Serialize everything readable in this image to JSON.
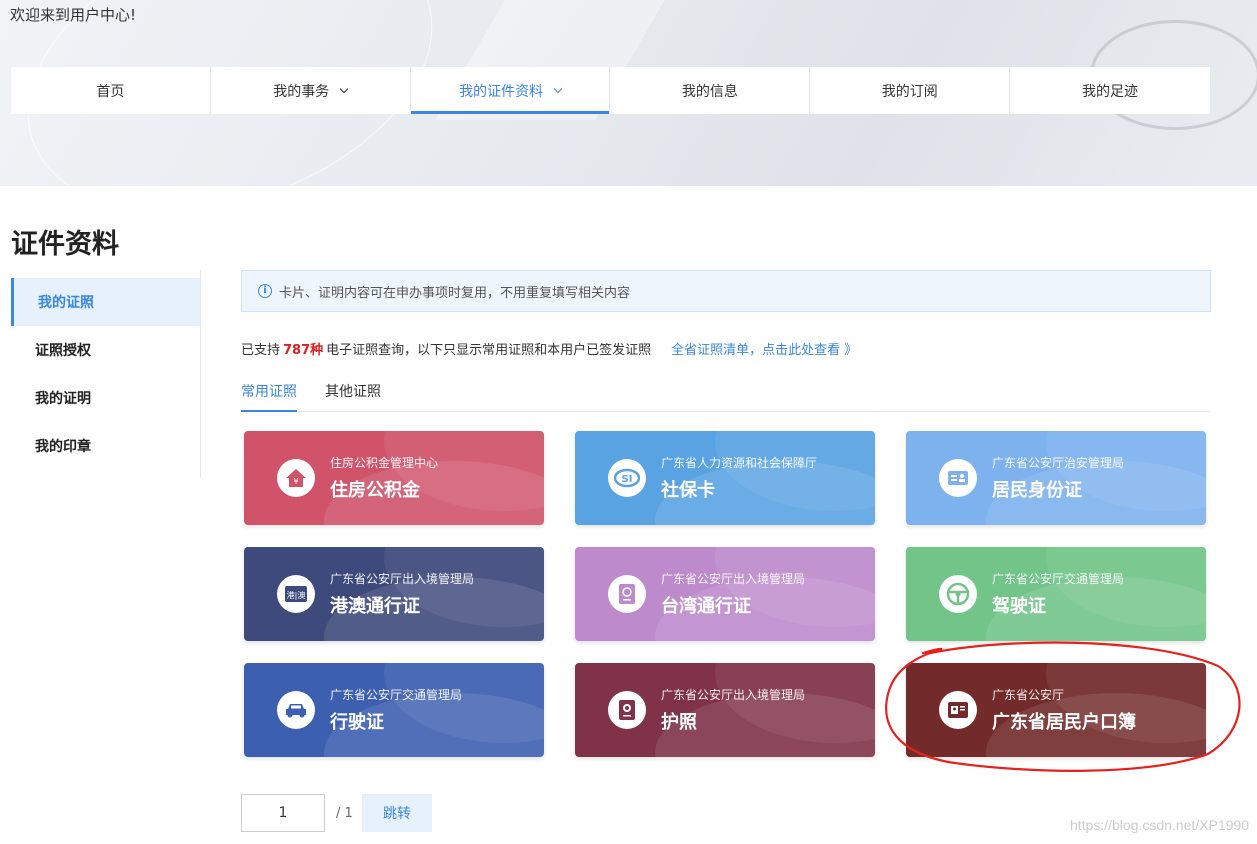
{
  "welcome": "欢迎来到用户中心!",
  "nav": [
    {
      "label": "首页",
      "dropdown": false,
      "active": false
    },
    {
      "label": "我的事务",
      "dropdown": true,
      "active": false
    },
    {
      "label": "我的证件资料",
      "dropdown": true,
      "active": true
    },
    {
      "label": "我的信息",
      "dropdown": false,
      "active": false
    },
    {
      "label": "我的订阅",
      "dropdown": false,
      "active": false
    },
    {
      "label": "我的足迹",
      "dropdown": false,
      "active": false
    }
  ],
  "page_title": "证件资料",
  "sidebar": {
    "items": [
      {
        "label": "我的证照",
        "active": true
      },
      {
        "label": "证照授权",
        "active": false
      },
      {
        "label": "我的证明",
        "active": false
      },
      {
        "label": "我的印章",
        "active": false
      }
    ]
  },
  "notice": {
    "icon": "info-icon",
    "text": "卡片、证明内容可在申办事项时复用，不用重复填写相关内容"
  },
  "summary": {
    "prefix": "已支持",
    "count": "787种",
    "suffix": "电子证照查询，以下只显示常用证照和本用户已签发证照",
    "link": "全省证照清单，点击此处查看 》"
  },
  "tabs": [
    {
      "label": "常用证照",
      "active": true
    },
    {
      "label": "其他证照",
      "active": false
    }
  ],
  "cards": [
    {
      "org": "住房公积金管理中心",
      "name": "住房公积金",
      "color": "#d0536a",
      "icon": "house-icon"
    },
    {
      "org": "广东省人力资源和社会保障厅",
      "name": "社保卡",
      "color": "#5aa3e2",
      "icon": "social-security-icon"
    },
    {
      "org": "广东省公安厅治安管理局",
      "name": "居民身份证",
      "color": "#7db2ef",
      "icon": "id-card-icon"
    },
    {
      "org": "广东省公安厅出入境管理局",
      "name": "港澳通行证",
      "color": "#3f4a7c",
      "icon": "hk-macau-pass-icon"
    },
    {
      "org": "广东省公安厅出入境管理局",
      "name": "台湾通行证",
      "color": "#bd8bcc",
      "icon": "taiwan-pass-icon"
    },
    {
      "org": "广东省公安厅交通管理局",
      "name": "驾驶证",
      "color": "#72c489",
      "icon": "steering-wheel-icon"
    },
    {
      "org": "广东省公安厅交通管理局",
      "name": "行驶证",
      "color": "#3d5fb0",
      "icon": "car-icon"
    },
    {
      "org": "广东省公安厅出入境管理局",
      "name": "护照",
      "color": "#7f3248",
      "icon": "passport-icon"
    },
    {
      "org": "广东省公安厅",
      "name": "广东省居民户口簿",
      "color": "#722a2a",
      "icon": "household-register-icon"
    }
  ],
  "pagination": {
    "current": "1",
    "total": "/ 1",
    "jump_label": "跳转"
  },
  "hk_icon_text": "港|澳",
  "watermark": "https://blog.csdn.net/XP1990"
}
